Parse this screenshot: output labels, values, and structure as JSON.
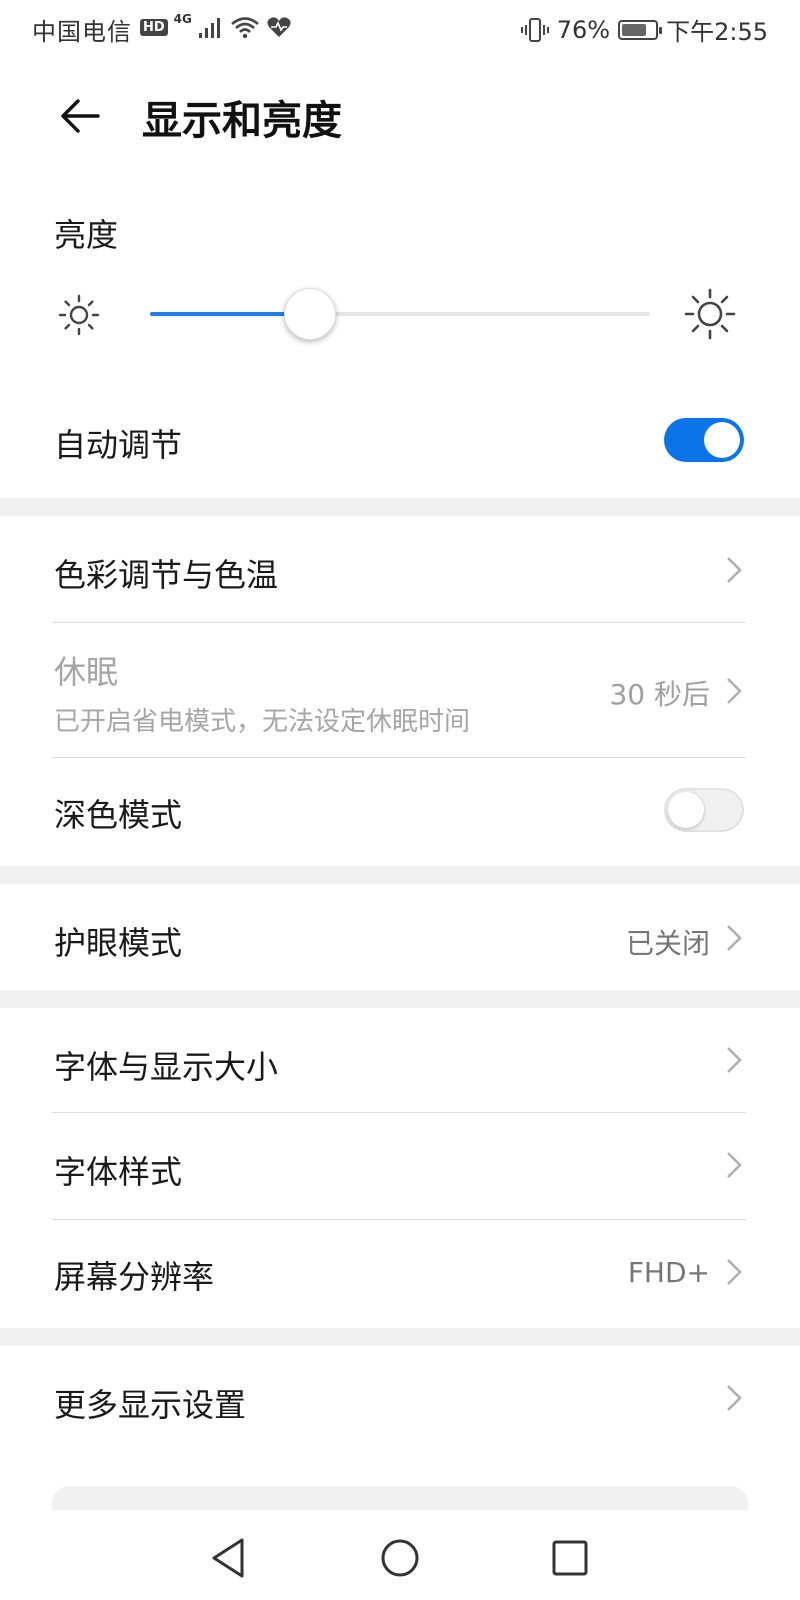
{
  "status_bar": {
    "carrier": "中国电信",
    "hd": "HD",
    "network": "4G",
    "battery": "76%",
    "battery_level": 0.76,
    "time": "下午2:55"
  },
  "header": {
    "back_icon": "arrow-left-icon",
    "title": "显示和亮度"
  },
  "brightness": {
    "label": "亮度",
    "level": 0.32,
    "icon_low": "sun-small-icon",
    "icon_high": "sun-large-icon",
    "accent": "#1e7fe6"
  },
  "auto_adjust": {
    "label": "自动调节",
    "on": true
  },
  "items": {
    "color_temp": {
      "label": "色彩调节与色温"
    },
    "sleep": {
      "label": "休眠",
      "sublabel": "已开启省电模式，无法设定休眠时间",
      "value": "30 秒后",
      "disabled": true
    },
    "dark_mode": {
      "label": "深色模式",
      "on": false
    },
    "eye_comfort": {
      "label": "护眼模式",
      "value": "已关闭"
    },
    "font_size": {
      "label": "字体与显示大小"
    },
    "font_style": {
      "label": "字体样式"
    },
    "resolution": {
      "label": "屏幕分辨率",
      "value": "FHD+"
    },
    "more_display": {
      "label": "更多显示设置"
    }
  },
  "navbar": {
    "back": "triangle-back-icon",
    "home": "circle-home-icon",
    "recents": "square-recents-icon"
  },
  "colors": {
    "toggle_on": "#0a74e8",
    "divider": "#dedede",
    "section_band": "#f1f1f1"
  }
}
